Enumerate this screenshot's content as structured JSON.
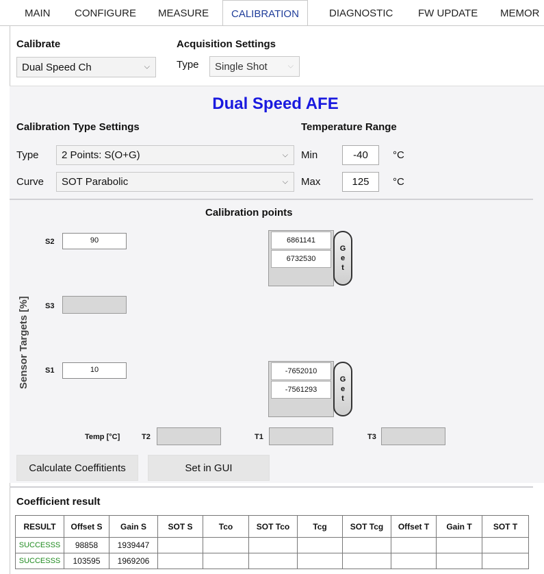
{
  "tabs": [
    {
      "label": "MAIN"
    },
    {
      "label": "CONFIGURE"
    },
    {
      "label": "MEASURE"
    },
    {
      "label": "CALIBRATION"
    },
    {
      "label": "DIAGNOSTIC"
    },
    {
      "label": "FW UPDATE"
    },
    {
      "label": "MEMOR"
    }
  ],
  "calibrate": {
    "heading": "Calibrate",
    "selected": "Dual Speed Ch",
    "icon": "chevron-down-icon"
  },
  "acquisition": {
    "heading": "Acquisition Settings",
    "type_label": "Type",
    "type_value": "Single Shot"
  },
  "afe_title": "Dual Speed AFE",
  "cal_type_settings": {
    "heading": "Calibration Type Settings",
    "type_label": "Type",
    "type_value": "2 Points: S(O+G)",
    "curve_label": "Curve",
    "curve_value": "SOT Parabolic"
  },
  "temperature_range": {
    "heading": "Temperature Range",
    "min_label": "Min",
    "min_value": "-40",
    "max_label": "Max",
    "max_value": "125",
    "unit": "°C"
  },
  "calibration_points": {
    "heading": "Calibration points",
    "axis_label": "Sensor Targets [%]",
    "s2_label": "S2",
    "s2_value": "90",
    "s3_label": "S3",
    "s1_label": "S1",
    "s1_value": "10",
    "s2_readings": [
      "6861141",
      "6732530"
    ],
    "s1_readings": [
      "-7652010",
      "-7561293"
    ],
    "get_label": [
      "G",
      "e",
      "t"
    ],
    "temp_label": "Temp [°C]",
    "t2_label": "T2",
    "t1_label": "T1",
    "t3_label": "T3"
  },
  "buttons": {
    "calculate": "Calculate Coeffitients",
    "set_gui": "Set in GUI"
  },
  "coefficient_result": {
    "heading": "Coefficient result",
    "columns": [
      "RESULT",
      "Offset S",
      "Gain S",
      "SOT S",
      "Tco",
      "SOT Tco",
      "Tcg",
      "SOT Tcg",
      "Offset T",
      "Gain T",
      "SOT T"
    ],
    "rows": [
      [
        "SUCCESSS",
        "98858",
        "1939447",
        "",
        "",
        "",
        "",
        "",
        "",
        "",
        ""
      ],
      [
        "SUCCESSS",
        "103595",
        "1969206",
        "",
        "",
        "",
        "",
        "",
        "",
        "",
        ""
      ]
    ]
  },
  "colors": {
    "accent": "#1a1adf",
    "active_tab": "#1f3d9a",
    "success": "#1f8a1f"
  }
}
